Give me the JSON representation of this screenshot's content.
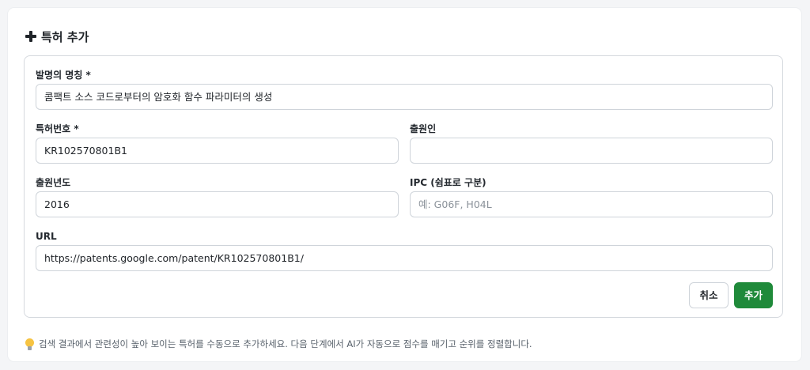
{
  "card": {
    "title": "특허 추가",
    "icon": "plus-icon"
  },
  "form": {
    "title_label": "발명의 명칭 *",
    "title_value": "콤팩트 소스 코드로부터의 암호화 함수 파라미터의 생성",
    "patent_number_label": "특허번호 *",
    "patent_number_value": "KR102570801B1",
    "applicant_label": "출원인",
    "applicant_value": "",
    "year_label": "출원년도",
    "year_value": "2016",
    "ipc_label": "IPC (쉼표로 구분)",
    "ipc_placeholder": "예: G06F, H04L",
    "url_label": "URL",
    "url_value": "https://patents.google.com/patent/KR102570801B1/"
  },
  "buttons": {
    "cancel_label": "취소",
    "add_label": "추가",
    "add_color": "#1f8a3a"
  },
  "hint": {
    "icon": "lightbulb-icon",
    "text": "검색 결과에서 관련성이 높아 보이는 특허를 수동으로 추가하세요. 다음 단계에서 AI가 자동으로 점수를 매기고 순위를 정렬합니다."
  }
}
